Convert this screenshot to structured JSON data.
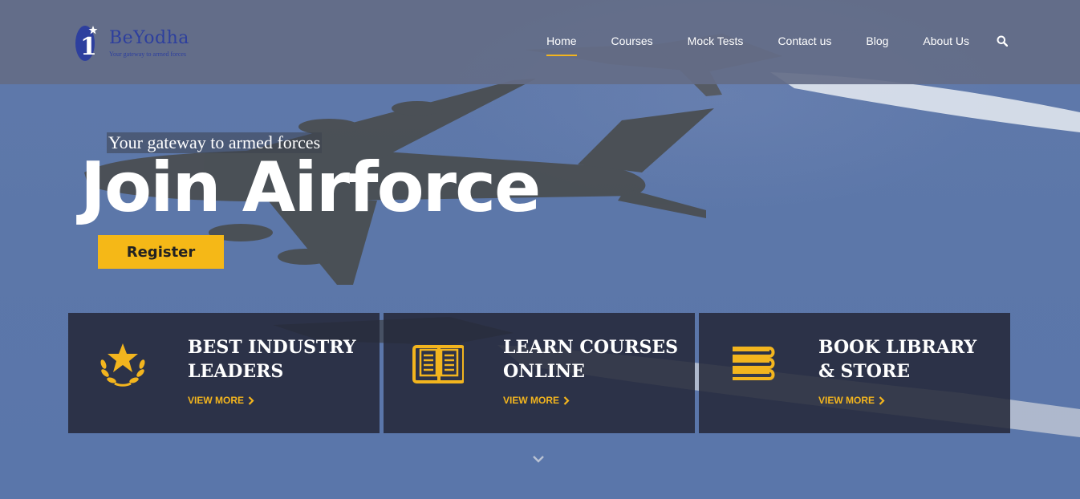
{
  "brand": {
    "name": "BeYodha",
    "tagline": "Your gateway to armed forces",
    "color": "#2d3f9e"
  },
  "nav": {
    "items": [
      {
        "label": "Home",
        "active": true
      },
      {
        "label": "Courses",
        "active": false
      },
      {
        "label": "Mock Tests",
        "active": false
      },
      {
        "label": "Contact us",
        "active": false
      },
      {
        "label": "Blog",
        "active": false
      },
      {
        "label": "About Us",
        "active": false
      }
    ],
    "search_icon": "search-icon"
  },
  "hero": {
    "tagline": "Your gateway to armed forces",
    "title": "Join Airforce",
    "register_label": "Register"
  },
  "features": [
    {
      "icon": "laurel-star-icon",
      "title_line1": "BEST INDUSTRY",
      "title_line2": "LEADERS",
      "link": "VIEW MORE"
    },
    {
      "icon": "open-book-icon",
      "title_line1": "LEARN COURSES",
      "title_line2": "ONLINE",
      "link": "VIEW MORE"
    },
    {
      "icon": "book-stack-icon",
      "title_line1": "BOOK LIBRARY",
      "title_line2": "& STORE",
      "link": "VIEW MORE"
    }
  ],
  "colors": {
    "accent": "#f3b51e",
    "header_bg": "#646c87",
    "card_bg": "#25293a"
  }
}
